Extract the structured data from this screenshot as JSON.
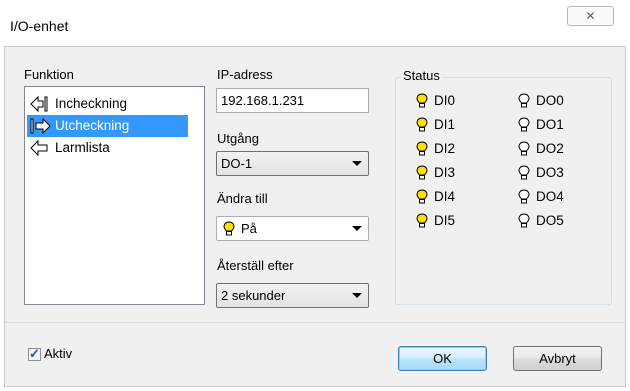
{
  "window": {
    "title": "I/O-enhet",
    "close_glyph": "✕"
  },
  "function_panel": {
    "label": "Funktion",
    "items": [
      {
        "label": "Incheckning",
        "icon": "arrow-in-icon",
        "selected": false
      },
      {
        "label": "Utcheckning",
        "icon": "arrow-out-icon",
        "selected": true
      },
      {
        "label": "Larmlista",
        "icon": "arrow-back-icon",
        "selected": false
      }
    ]
  },
  "settings": {
    "ip_label": "IP-adress",
    "ip_value": "192.168.1.231",
    "output_label": "Utgång",
    "output_value": "DO-1",
    "change_label": "Ändra till",
    "change_value": "På",
    "reset_label": "Återställ efter",
    "reset_value": "2 sekunder"
  },
  "status": {
    "title": "Status",
    "inputs": [
      {
        "label": "DI0",
        "on": true
      },
      {
        "label": "DI1",
        "on": true
      },
      {
        "label": "DI2",
        "on": true
      },
      {
        "label": "DI3",
        "on": true
      },
      {
        "label": "DI4",
        "on": true
      },
      {
        "label": "DI5",
        "on": true
      }
    ],
    "outputs": [
      {
        "label": "DO0",
        "on": false
      },
      {
        "label": "DO1",
        "on": false
      },
      {
        "label": "DO2",
        "on": false
      },
      {
        "label": "DO3",
        "on": false
      },
      {
        "label": "DO4",
        "on": false
      },
      {
        "label": "DO5",
        "on": false
      }
    ]
  },
  "footer": {
    "active_label": "Aktiv",
    "active_checked": true,
    "ok_label": "OK",
    "cancel_label": "Avbryt"
  },
  "colors": {
    "selection": "#3399ff",
    "bulb_on": "#ffe000",
    "bulb_off": "#ffffff"
  }
}
